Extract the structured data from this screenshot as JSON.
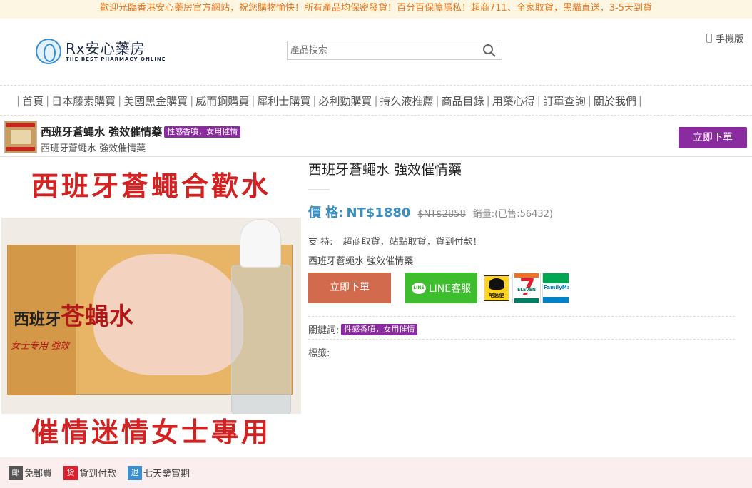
{
  "notice": "歡迎光臨香港安心藥房官方網站，祝您購物愉快！所有產品均保密發貨！百分百保障隱私！超商711、全家取貨，黑貓直送，3-5天到貨",
  "header": {
    "logo_title": "Rx安心藥房",
    "logo_subtitle": "THE BEST PHARMACY ONLINE",
    "search_placeholder": "產品搜索",
    "mobile_label": "手機版"
  },
  "nav": {
    "items": [
      "首頁",
      "日本藤素購買",
      "美國黑金購買",
      "威而鋼購買",
      "犀利士購買",
      "必利勁購買",
      "持久液推薦",
      "商品目錄",
      "用藥心得",
      "訂單查詢",
      "關於我們"
    ]
  },
  "sticky": {
    "title": "西班牙蒼蠅水 強效催情藥",
    "tag": "性感香噴，女用催情",
    "subtitle": "西班牙蒼蠅水 強效催情藥",
    "buy_label": "立即下單"
  },
  "image": {
    "top_text": "西班牙蒼蠅合歡水",
    "box_brand": "西班牙",
    "box_product": "苍蝇水",
    "box_small": "女士专用 強效",
    "bottom_text": "催情迷情女士專用"
  },
  "product": {
    "title": "西班牙蒼蠅水 強效催情藥",
    "price_label": "價 格:",
    "price": "NT$1880",
    "old_price": "$NT$2858",
    "sold": "銷量:(已售:56432)",
    "support_label": "支 持:",
    "support_text": "超商取貨，站點取貨，貨到付款！",
    "subname": "西班牙蒼蠅水 強效催情藥",
    "buy_label": "立即下單",
    "line_label": "LINE客服",
    "line_icon_text": "LINE",
    "kuro_text": "宅急便",
    "seven_text": "ELEVEN",
    "seven_digit": "7",
    "fm_text": "FamilyMart",
    "keywords_label": "關鍵詞:",
    "keyword_tag": "性感香噴，女用催情",
    "tags_label": "標籤:"
  },
  "footer": {
    "items": [
      {
        "badge": "邮",
        "label": "免郵費",
        "color": "#555555"
      },
      {
        "badge": "货",
        "label": "貨到付款",
        "color": "#e01e2d"
      },
      {
        "badge": "退",
        "label": "七天鑒賞期",
        "color": "#3a8fd2"
      }
    ]
  }
}
